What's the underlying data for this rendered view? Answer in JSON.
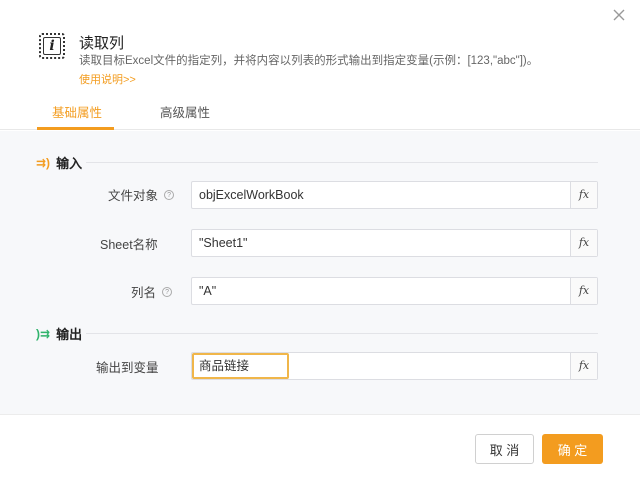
{
  "dialog": {
    "title": "读取列",
    "description": "读取目标Excel文件的指定列，并将内容以列表的形式输出到指定变量(示例：[123,\"abc\"])。",
    "help_link": "使用说明>>"
  },
  "tabs": [
    {
      "label": "基础属性",
      "active": true
    },
    {
      "label": "高级属性",
      "active": false
    }
  ],
  "sections": {
    "input": {
      "title": "输入"
    },
    "output": {
      "title": "输出"
    }
  },
  "fields": {
    "file_object": {
      "label": "文件对象",
      "value": "objExcelWorkBook"
    },
    "sheet_name": {
      "label": "Sheet名称",
      "value": "\"Sheet1\""
    },
    "column_name": {
      "label": "列名",
      "value": "\"A\""
    },
    "output_var": {
      "label": "输出到变量",
      "value": "商品链接"
    }
  },
  "fx_label": "fx",
  "buttons": {
    "cancel": "取 消",
    "ok": "确 定"
  },
  "colors": {
    "accent": "#f39c1f",
    "output_icon": "#2fb36b"
  }
}
